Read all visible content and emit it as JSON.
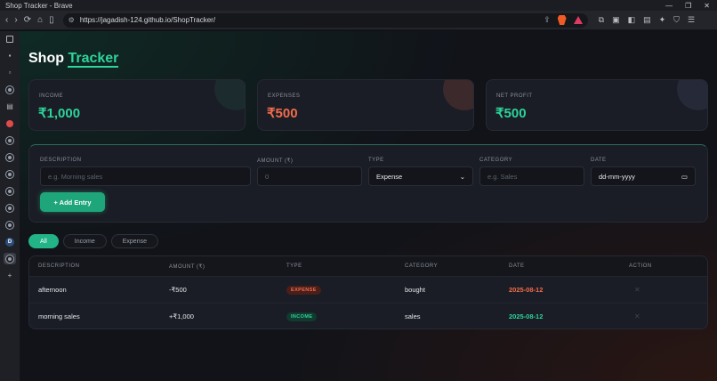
{
  "browser": {
    "window_title": "Shop Tracker - Brave",
    "url": "https://jagadish-124.github.io/ShopTracker/",
    "window_controls": [
      "—",
      "❐",
      "✕"
    ]
  },
  "app": {
    "brand_part1": "Shop",
    "brand_part2": "Tracker"
  },
  "summary": [
    {
      "label": "INCOME",
      "amount": "₹1,000",
      "color": "#2dd49b"
    },
    {
      "label": "EXPENSES",
      "amount": "₹500",
      "color": "#f26b4c"
    },
    {
      "label": "NET PROFIT",
      "amount": "₹500",
      "color": "#2dd49b"
    }
  ],
  "form": {
    "description_label": "DESCRIPTION",
    "description_placeholder": "e.g. Morning sales",
    "amount_label": "AMOUNT (₹)",
    "amount_placeholder": "0",
    "type_label": "TYPE",
    "type_value": "Expense",
    "category_label": "CATEGORY",
    "category_placeholder": "e.g. Sales",
    "date_label": "DATE",
    "date_placeholder": "dd-mm-yyyy",
    "add_button": "+ Add Entry"
  },
  "filters": {
    "all": "All",
    "income": "Income",
    "expense": "Expense",
    "active": "All"
  },
  "table": {
    "headers": {
      "description": "DESCRIPTION",
      "amount": "AMOUNT (₹)",
      "type": "TYPE",
      "category": "CATEGORY",
      "date": "DATE",
      "action": "ACTION"
    },
    "rows": [
      {
        "description": "afternoon",
        "amount": "-₹500",
        "type": "EXPENSE",
        "category": "bought",
        "date": "2025-08-12",
        "action": "✕"
      },
      {
        "description": "morning sales",
        "amount": "+₹1,000",
        "type": "INCOME",
        "category": "sales",
        "date": "2025-08-12",
        "action": "✕"
      }
    ]
  }
}
